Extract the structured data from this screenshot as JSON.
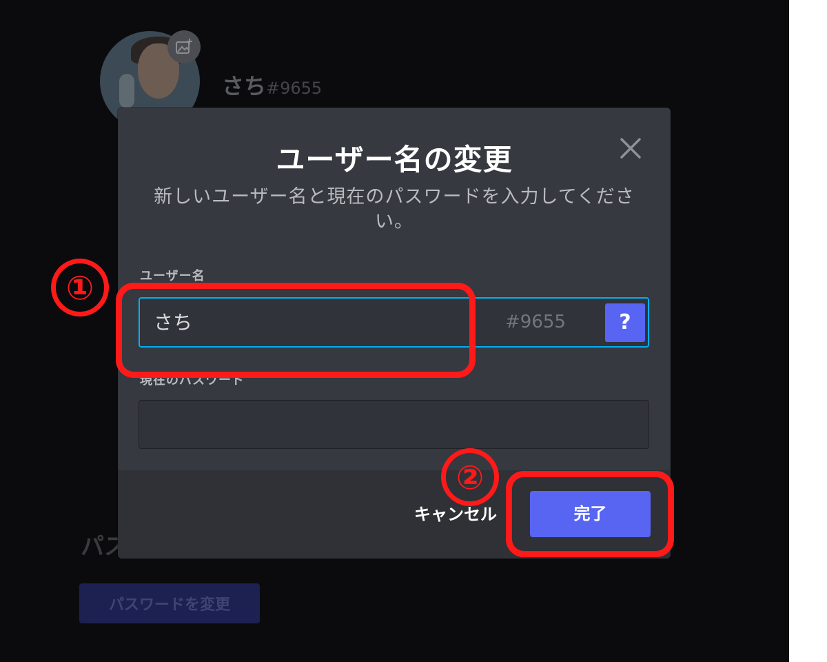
{
  "background": {
    "username": "さち",
    "tag": "#9655",
    "section_title": "パス",
    "change_password_button": "パスワードを変更"
  },
  "modal": {
    "title": "ユーザー名の変更",
    "subtitle": "新しいユーザー名と現在のパスワードを入力してください。",
    "username_label": "ユーザー名",
    "username_value": "さち",
    "discriminator": "#9655",
    "help_label": "?",
    "password_label": "現在のパスワード",
    "password_value": "",
    "cancel_label": "キャンセル",
    "done_label": "完了"
  },
  "annotations": {
    "step1": "①",
    "step2": "②",
    "color": "#ff1a1a"
  },
  "colors": {
    "accent": "#5865f2",
    "focus_border": "#00b0f4",
    "modal_bg": "#36393f",
    "footer_bg": "#2f3136"
  }
}
